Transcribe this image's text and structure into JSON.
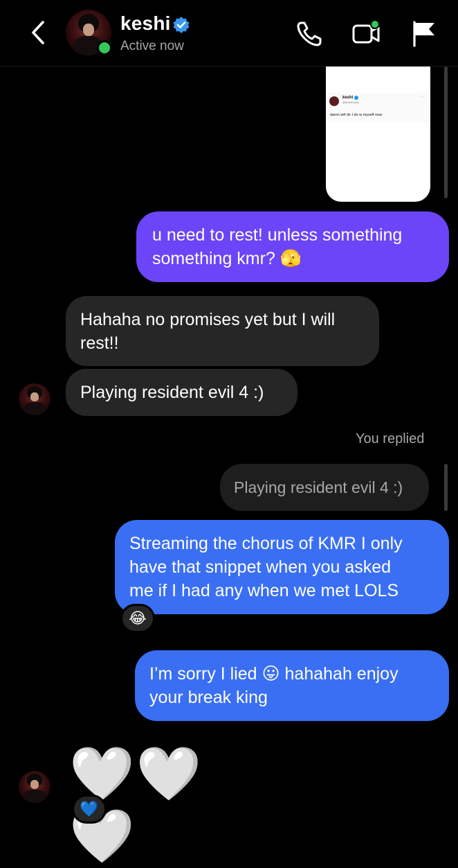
{
  "header": {
    "contact_name": "keshi",
    "status": "Active now",
    "icons": [
      "back-chevron-icon",
      "verified-badge-icon",
      "phone-icon",
      "video-camera-icon",
      "flag-icon"
    ]
  },
  "shared_image": {
    "tweet_name": "keshi",
    "tweet_handle": "@keshimusic",
    "tweet_text": "damn wtf do I do w myself now"
  },
  "messages": [
    {
      "id": "m1",
      "side": "sent",
      "color": "#6b45f7",
      "lines": [
        "u need to rest! unless something",
        "something kmr? 🫣"
      ]
    },
    {
      "id": "m2",
      "side": "received",
      "lines": [
        "Hahaha no promises yet but I will",
        "rest!!"
      ]
    },
    {
      "id": "m3",
      "side": "received",
      "lines": [
        "Playing resident evil 4 :)"
      ]
    },
    {
      "id": "m4",
      "side": "sent",
      "reply_label": "You replied",
      "reply_to": "Playing resident evil 4 :)",
      "color": "#3a6ff3",
      "lines": [
        "Streaming the chorus of KMR I only",
        "have that snippet when you asked",
        "me if I had any when we met LOLS"
      ],
      "reaction": "😂"
    },
    {
      "id": "m5",
      "side": "sent",
      "color": "#3a6ff3",
      "lines": [
        "I’m sorry I lied 😛 hahahah enjoy",
        "your break king"
      ]
    },
    {
      "id": "m6",
      "side": "received",
      "type": "hearts",
      "content": "🤍🤍🤍",
      "reaction": "💙"
    }
  ],
  "colors": {
    "background": "#000000",
    "sent_purple": "#6b45f7",
    "sent_blue": "#3a6ff3",
    "received": "#262626",
    "online": "#35c759",
    "verified": "#3897f0"
  }
}
